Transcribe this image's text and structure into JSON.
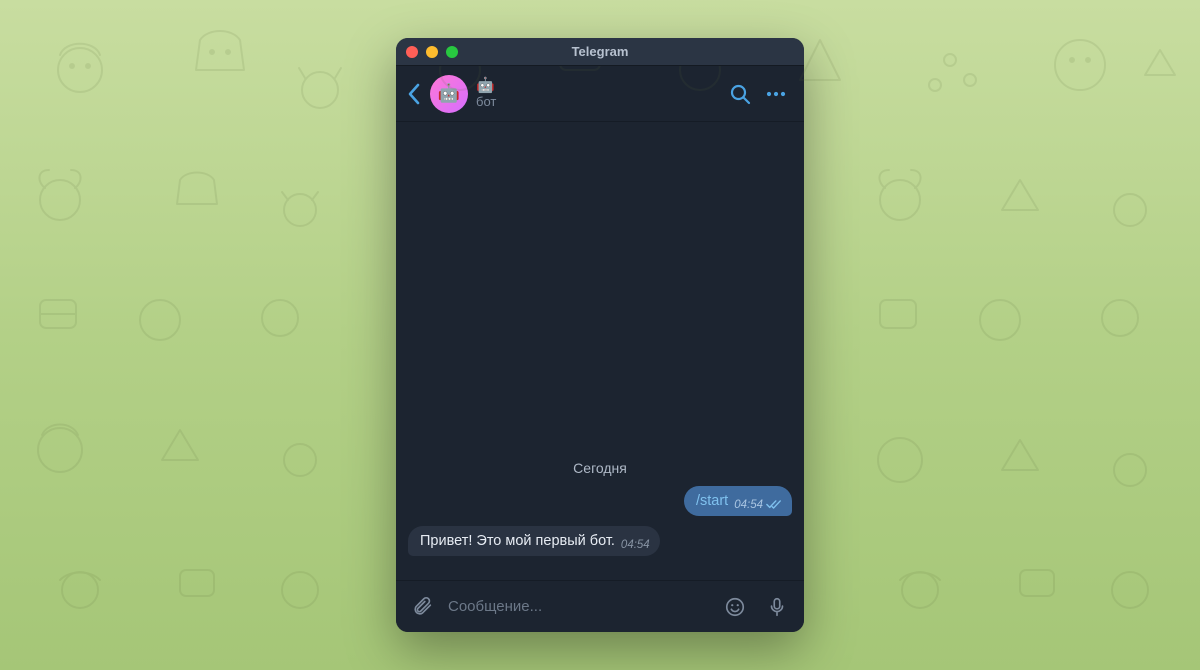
{
  "app": {
    "title": "Telegram"
  },
  "header": {
    "chat_name_emoji": "🤖",
    "chat_subtitle": "бот",
    "avatar_emoji": "🤖"
  },
  "chat": {
    "date_label": "Сегодня",
    "messages": [
      {
        "side": "out",
        "text": "/start",
        "time": "04:54",
        "read": true,
        "is_command": true
      },
      {
        "side": "in",
        "text": "Привет! Это мой первый бот.",
        "time": "04:54"
      }
    ]
  },
  "composer": {
    "placeholder": "Сообщение..."
  },
  "colors": {
    "accent": "#4aa3e3",
    "bg": "#1c2430",
    "bubble_out": "#3f6b9e",
    "bubble_in": "#2a3342"
  }
}
